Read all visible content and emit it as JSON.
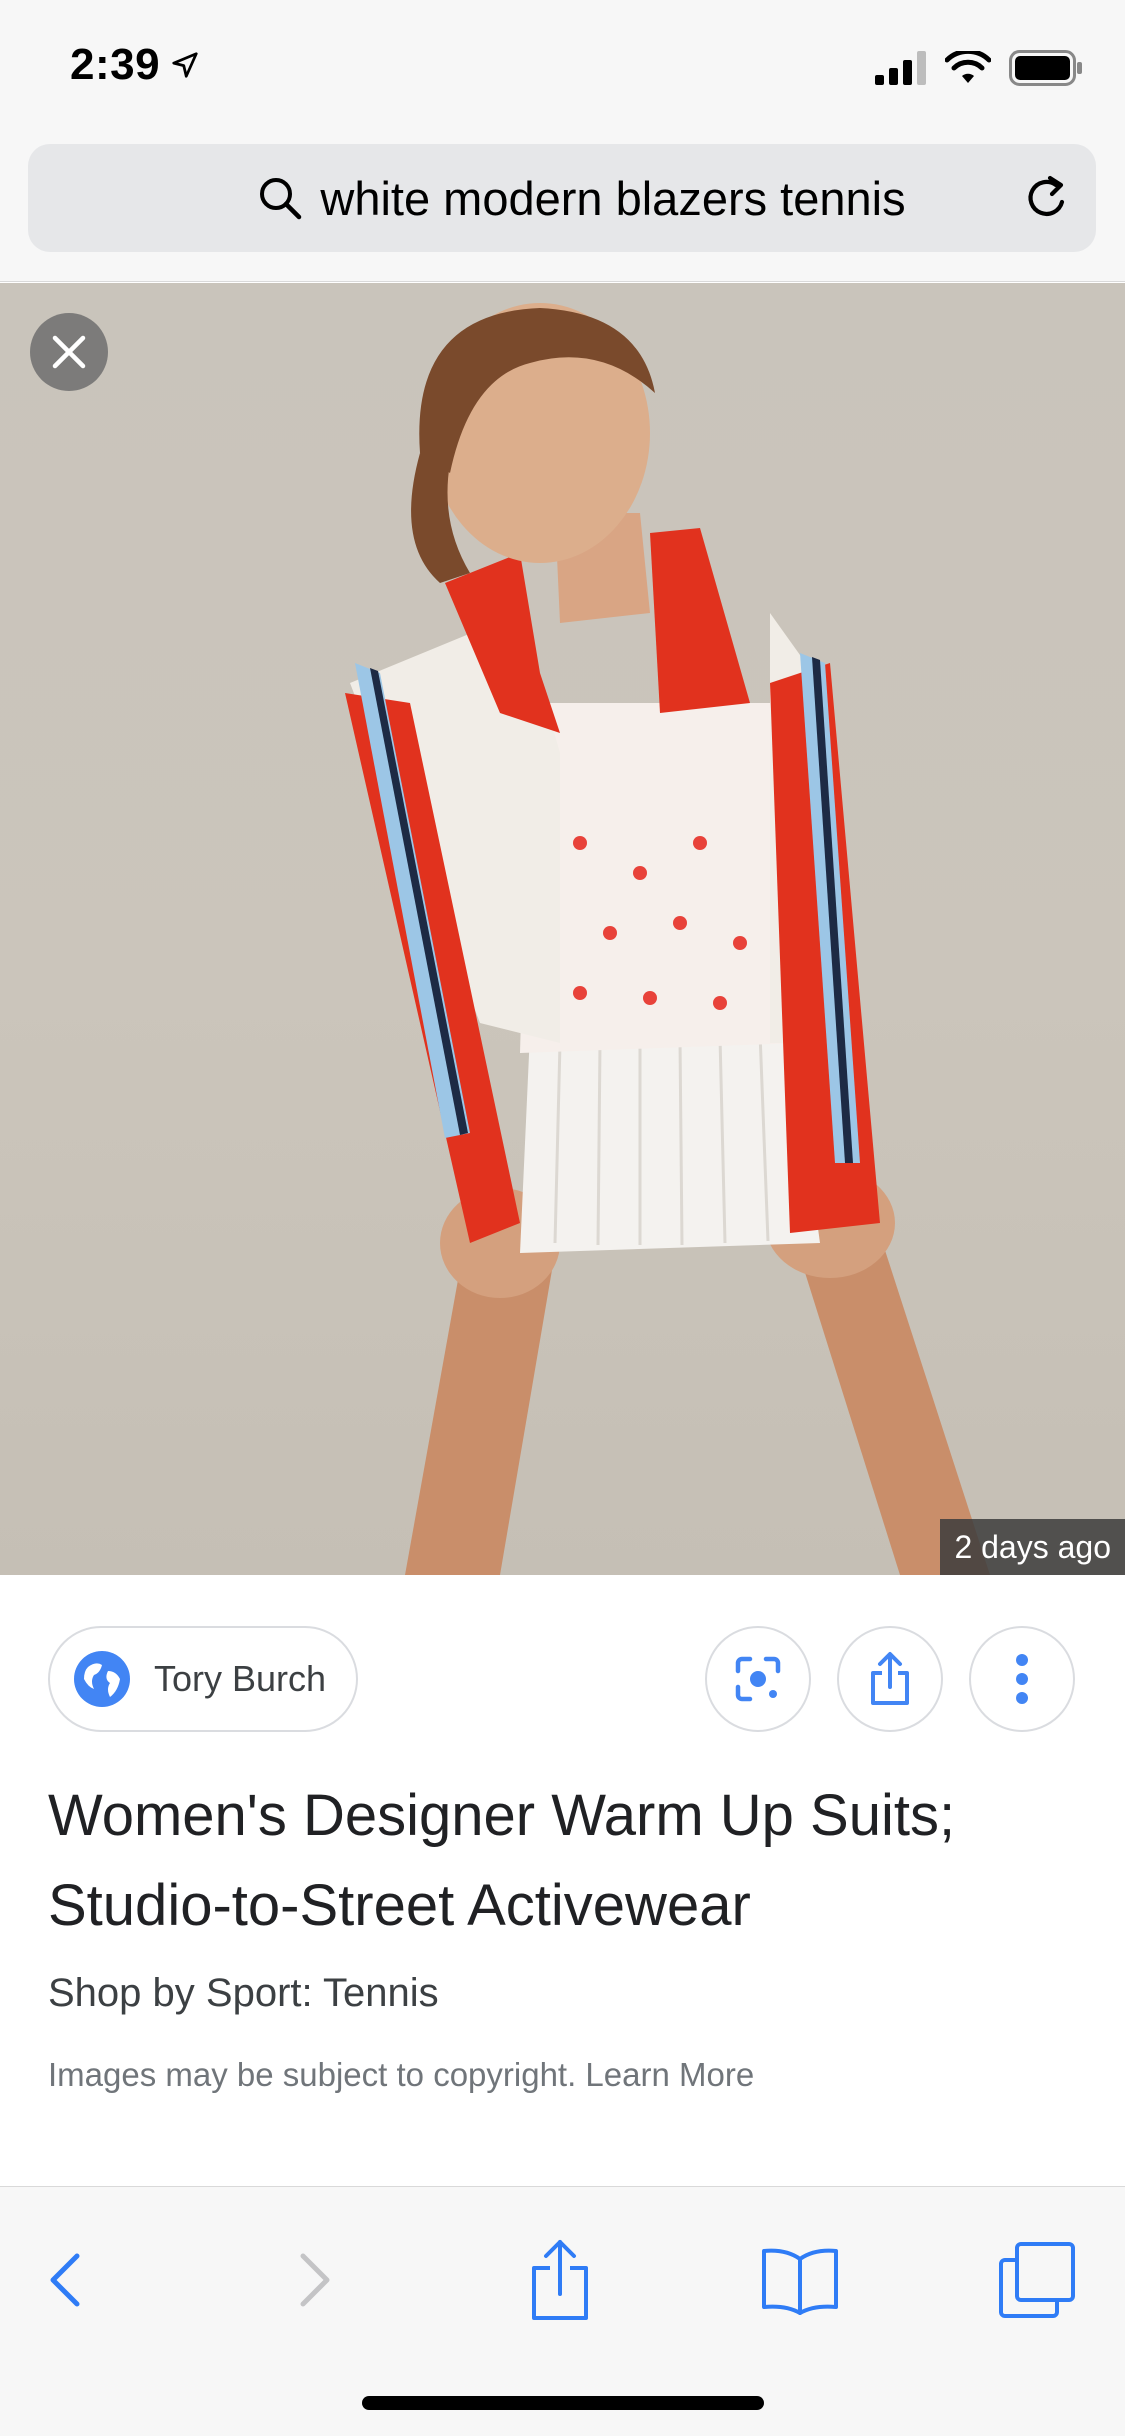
{
  "status_bar": {
    "time": "2:39",
    "icons": [
      "location-arrow-icon",
      "cellular-signal-icon",
      "wifi-icon",
      "battery-icon"
    ]
  },
  "address_bar": {
    "query": "white modern blazers tennis",
    "icons": [
      "search-icon",
      "reload-icon"
    ]
  },
  "image_viewer": {
    "close_icon": "close-icon",
    "age_badge": "2 days ago",
    "colors": {
      "backdrop": "#c9c4bb",
      "jacket_red": "#e1321e",
      "jacket_white": "#f3efe9",
      "stripe_blue": "#9cc6e6"
    }
  },
  "result": {
    "source": "Tory Burch",
    "title": "Women's Designer Warm Up Suits; Studio-to-Street Activewear",
    "subtitle": "Shop by Sport: Tennis",
    "copyright": "Images may be subject to copyright. Learn More",
    "actions": [
      "lens-icon",
      "share-icon",
      "more-vert-icon"
    ]
  },
  "toolbar": {
    "items": [
      "back-icon",
      "forward-icon",
      "share-icon",
      "bookmarks-icon",
      "tabs-icon"
    ],
    "accent": "#2f7cf6",
    "disabled": "#c4c4c6"
  }
}
